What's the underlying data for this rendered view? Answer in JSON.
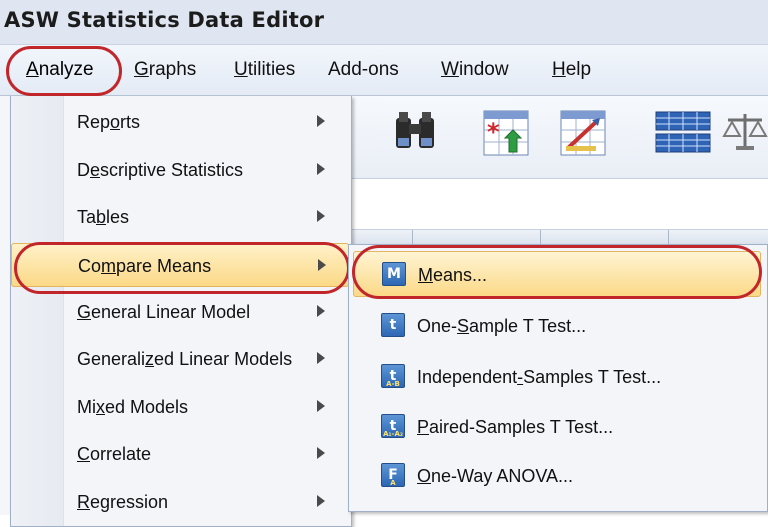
{
  "window": {
    "title": "ASW Statistics Data Editor"
  },
  "menubar": {
    "items": [
      {
        "label": "Analyze",
        "mnemonic": "A",
        "rest": "nalyze"
      },
      {
        "label": "Graphs",
        "mnemonic": "G",
        "rest": "raphs"
      },
      {
        "label": "Utilities",
        "mnemonic": "U",
        "rest": "tilities"
      },
      {
        "label": "Add-ons",
        "mnemonic": "",
        "rest": "Add-ons"
      },
      {
        "label": "Window",
        "mnemonic": "W",
        "rest": "indow"
      },
      {
        "label": "Help",
        "mnemonic": "H",
        "rest": "elp"
      }
    ]
  },
  "analyze_menu": {
    "items": [
      {
        "label": "Reports",
        "pre": "Rep",
        "mnemonic": "o",
        "post": "rts",
        "submenu": true
      },
      {
        "label": "Descriptive Statistics",
        "pre": "D",
        "mnemonic": "e",
        "post": "scriptive Statistics",
        "submenu": true
      },
      {
        "label": "Tables",
        "pre": "Ta",
        "mnemonic": "b",
        "post": "les",
        "submenu": true
      },
      {
        "label": "Compare Means",
        "pre": "Co",
        "mnemonic": "m",
        "post": "pare Means",
        "submenu": true,
        "highlighted": true
      },
      {
        "label": "General Linear Model",
        "pre": "",
        "mnemonic": "G",
        "post": "eneral Linear Model",
        "submenu": true
      },
      {
        "label": "Generalized Linear Models",
        "pre": "Generali",
        "mnemonic": "z",
        "post": "ed Linear Models",
        "submenu": true
      },
      {
        "label": "Mixed Models",
        "pre": "Mi",
        "mnemonic": "x",
        "post": "ed Models",
        "submenu": true
      },
      {
        "label": "Correlate",
        "pre": "",
        "mnemonic": "C",
        "post": "orrelate",
        "submenu": true
      },
      {
        "label": "Regression",
        "pre": "",
        "mnemonic": "R",
        "post": "egression",
        "submenu": true
      }
    ]
  },
  "compare_means_submenu": {
    "items": [
      {
        "label": "Means...",
        "pre": "",
        "mnemonic": "M",
        "post": "eans...",
        "icon": "means-icon",
        "glyph": "M",
        "sub": "",
        "highlighted": true
      },
      {
        "label": "One-Sample T Test...",
        "pre": "One-",
        "mnemonic": "S",
        "post": "ample T Test...",
        "icon": "one-sample-t-icon",
        "glyph": "t",
        "sub": ""
      },
      {
        "label": "Independent-Samples T Test...",
        "pre": "Independent",
        "mnemonic": "-",
        "post": "Samples T Test...",
        "icon": "independent-t-icon",
        "glyph": "t",
        "sub": "A-B"
      },
      {
        "label": "Paired-Samples T Test...",
        "pre": "",
        "mnemonic": "P",
        "post": "aired-Samples T Test...",
        "icon": "paired-t-icon",
        "glyph": "t",
        "sub": "A₁-A₂"
      },
      {
        "label": "One-Way ANOVA...",
        "pre": "",
        "mnemonic": "O",
        "post": "ne-Way ANOVA...",
        "icon": "anova-icon",
        "glyph": "F",
        "sub": "A"
      }
    ]
  },
  "colors": {
    "highlight_oval": "#c0262a",
    "hover_fill": "#fbd987",
    "menu_bg": "#f3f5f9",
    "titlebar_bg": "#dfe6f1"
  }
}
